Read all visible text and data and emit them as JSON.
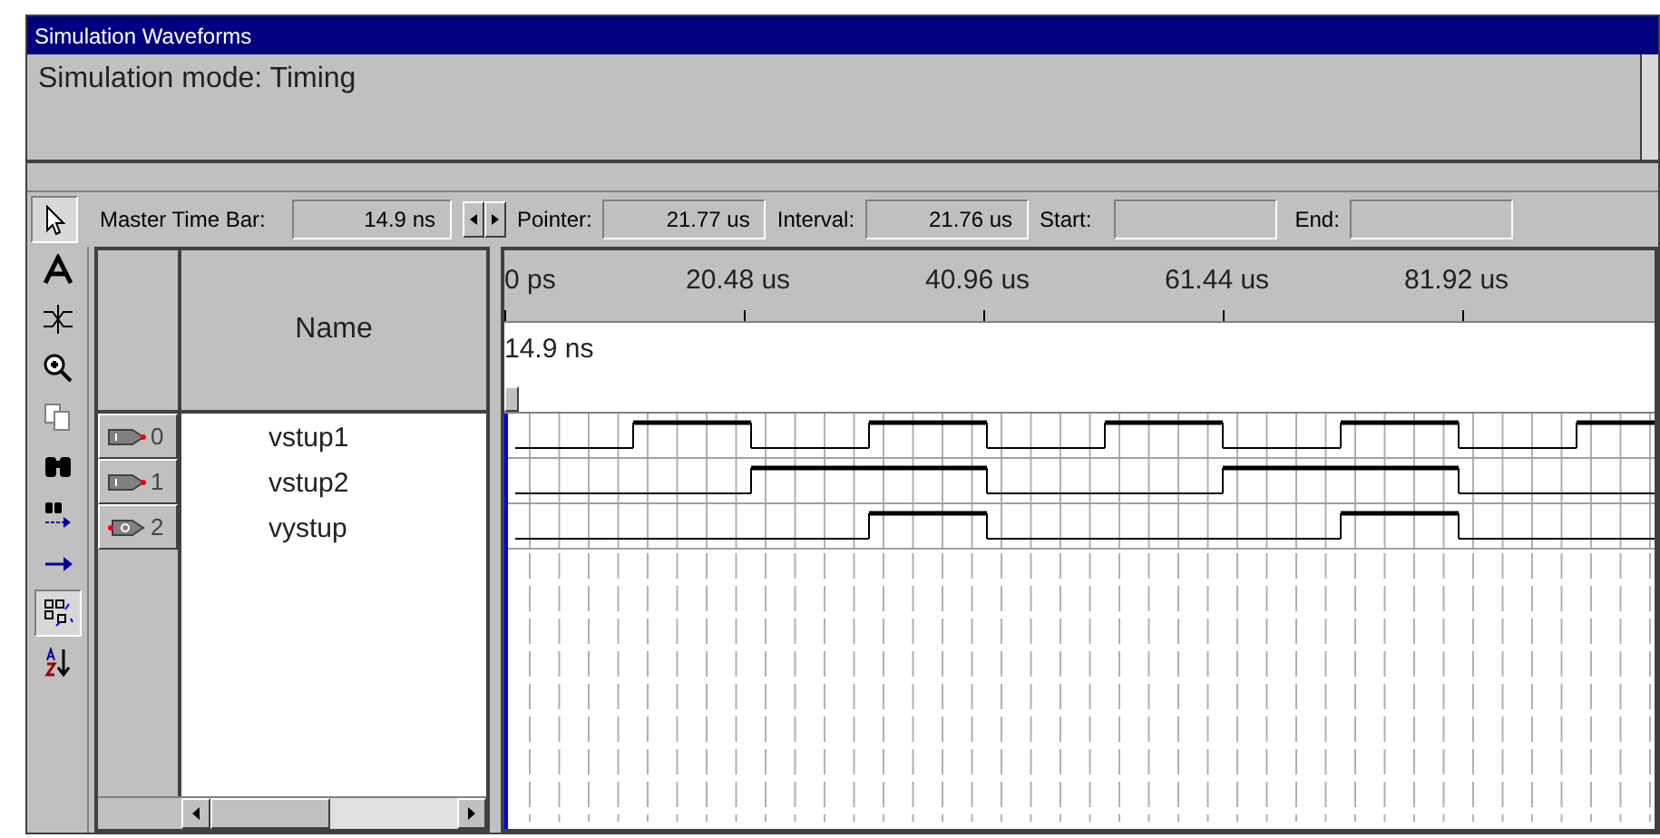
{
  "window": {
    "title": "Simulation Waveforms"
  },
  "message": "Simulation mode: Timing",
  "time_bar": {
    "master_label": "Master Time Bar:",
    "master_value": "14.9 ns",
    "pointer_label": "Pointer:",
    "pointer_value": "21.77 us",
    "interval_label": "Interval:",
    "interval_value": "21.76 us",
    "start_label": "Start:",
    "end_label": "End:"
  },
  "tools": [
    {
      "kind": "pointer",
      "selected": true
    },
    {
      "kind": "text",
      "selected": false
    },
    {
      "kind": "waveform",
      "selected": false
    },
    {
      "kind": "zoom",
      "selected": false
    },
    {
      "kind": "copy",
      "selected": false
    },
    {
      "kind": "find",
      "selected": false
    },
    {
      "kind": "find-next",
      "selected": false
    },
    {
      "kind": "arrow",
      "selected": false
    },
    {
      "kind": "grid",
      "selected": true
    },
    {
      "kind": "sort",
      "selected": false
    }
  ],
  "name_column": "Name",
  "signals": [
    {
      "number": "0",
      "name": "vstup1",
      "kind": "input"
    },
    {
      "number": "1",
      "name": "vstup2",
      "kind": "input"
    },
    {
      "number": "2",
      "name": "vystup",
      "kind": "output"
    }
  ],
  "timeline": {
    "ticks": [
      "0 ps",
      "20.48 us",
      "40.96 us",
      "61.44 us",
      "81.92 us"
    ],
    "marker": "14.9 ns"
  }
}
